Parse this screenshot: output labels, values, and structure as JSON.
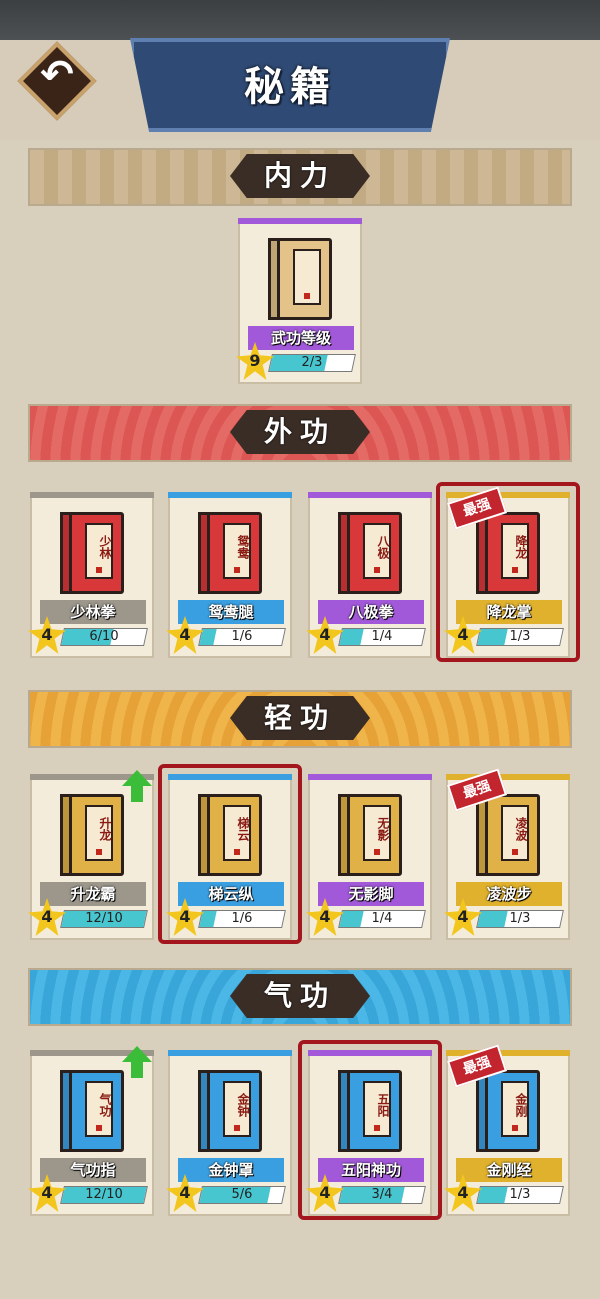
{
  "header": {
    "title": "秘籍",
    "back_icon": "↶"
  },
  "sections": {
    "neili": {
      "title": "内力",
      "color": "#c7a87d",
      "cards": [
        {
          "name": "武功等级",
          "stars": "9",
          "progress": "2/3",
          "fraction": 0.667,
          "name_color": "#a259d9",
          "book_color": "#e3c38a",
          "chars": ""
        }
      ]
    },
    "waigong": {
      "title": "外功",
      "color": "#e25d5a",
      "cards": [
        {
          "name": "少林拳",
          "chars": "少林",
          "stars": "4",
          "progress": "6/10",
          "fraction": 0.6,
          "name_color": "#9c968b",
          "book_color": "#d8383a"
        },
        {
          "name": "鸳鸯腿",
          "chars": "鸳鸯",
          "stars": "4",
          "progress": "1/6",
          "fraction": 0.167,
          "name_color": "#3a9fe0",
          "book_color": "#d8383a"
        },
        {
          "name": "八极拳",
          "chars": "八极",
          "stars": "4",
          "progress": "1/4",
          "fraction": 0.25,
          "name_color": "#a259d9",
          "book_color": "#d8383a"
        },
        {
          "name": "降龙掌",
          "chars": "降龙",
          "stars": "4",
          "progress": "1/3",
          "fraction": 0.333,
          "name_color": "#e0b12c",
          "book_color": "#d8383a",
          "badge": "最强"
        }
      ]
    },
    "qinggong": {
      "title": "轻功",
      "color": "#e9a93a",
      "cards": [
        {
          "name": "升龙霸",
          "chars": "升龙",
          "stars": "4",
          "progress": "12/10",
          "fraction": 1.0,
          "name_color": "#9c968b",
          "book_color": "#e0b147",
          "upgrade": true
        },
        {
          "name": "梯云纵",
          "chars": "梯云",
          "stars": "4",
          "progress": "1/6",
          "fraction": 0.167,
          "name_color": "#3a9fe0",
          "book_color": "#e0b147"
        },
        {
          "name": "无影脚",
          "chars": "无影",
          "stars": "4",
          "progress": "1/4",
          "fraction": 0.25,
          "name_color": "#a259d9",
          "book_color": "#e0b147"
        },
        {
          "name": "凌波步",
          "chars": "凌波",
          "stars": "4",
          "progress": "1/3",
          "fraction": 0.333,
          "name_color": "#e0b12c",
          "book_color": "#e0b147",
          "badge": "最强"
        }
      ]
    },
    "qigong": {
      "title": "气功",
      "color": "#3aaee0",
      "cards": [
        {
          "name": "气功指",
          "chars": "气功",
          "stars": "4",
          "progress": "12/10",
          "fraction": 1.0,
          "name_color": "#9c968b",
          "book_color": "#3a9fe0",
          "upgrade": true
        },
        {
          "name": "金钟罩",
          "chars": "金钟",
          "stars": "4",
          "progress": "5/6",
          "fraction": 0.833,
          "name_color": "#3a9fe0",
          "book_color": "#3a9fe0"
        },
        {
          "name": "五阳神功",
          "chars": "五阳",
          "stars": "4",
          "progress": "3/4",
          "fraction": 0.75,
          "name_color": "#a259d9",
          "book_color": "#3a9fe0"
        },
        {
          "name": "金刚经",
          "chars": "金刚",
          "stars": "4",
          "progress": "1/3",
          "fraction": 0.333,
          "name_color": "#e0b12c",
          "book_color": "#3a9fe0",
          "badge": "最强"
        }
      ]
    }
  }
}
